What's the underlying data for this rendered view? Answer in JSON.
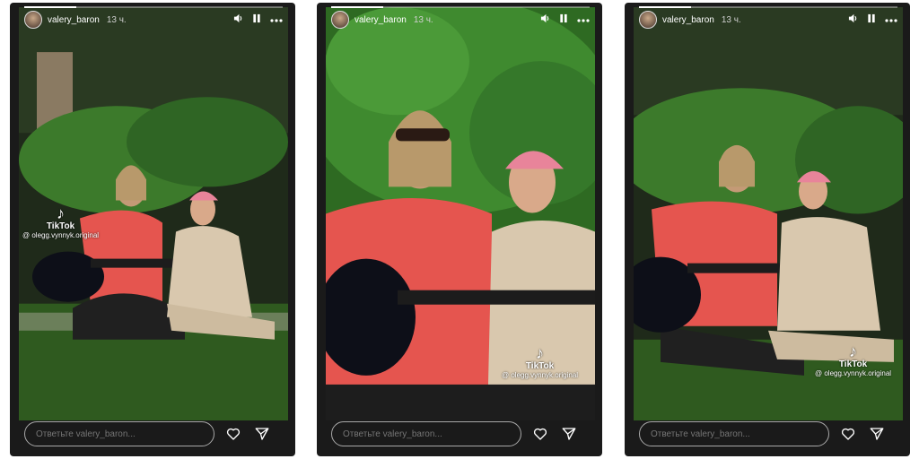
{
  "stories": [
    {
      "username": "valery_baron",
      "time": "13 ч.",
      "progress": 0.2,
      "reply_placeholder": "Ответьте valery_baron...",
      "watermark": {
        "brand": "TikTok",
        "handle": "@ olegg.vynnyk.original"
      }
    },
    {
      "username": "valery_baron",
      "time": "13 ч.",
      "progress": 0.2,
      "reply_placeholder": "Ответьте valery_baron...",
      "watermark": {
        "brand": "TikTok",
        "handle": "@ olegg.vynnyk.original"
      }
    },
    {
      "username": "valery_baron",
      "time": "13 ч.",
      "progress": 0.2,
      "reply_placeholder": "Ответьте valery_baron...",
      "watermark": {
        "brand": "TikTok",
        "handle": "@ olegg.vynnyk.original"
      }
    }
  ],
  "icons": {
    "volume": "volume-icon",
    "pause": "pause-icon",
    "more": "more-icon",
    "like": "heart-icon",
    "share": "send-icon",
    "tiktok": "tiktok-icon"
  },
  "colors": {
    "background": "#ffffff",
    "story_bg": "#1a1a1a",
    "shirt": "#e5554f",
    "foliage": "#3f8a2f",
    "grass": "#2f5a1f",
    "beige": "#d9c8ae",
    "cap": "#e8849a"
  }
}
